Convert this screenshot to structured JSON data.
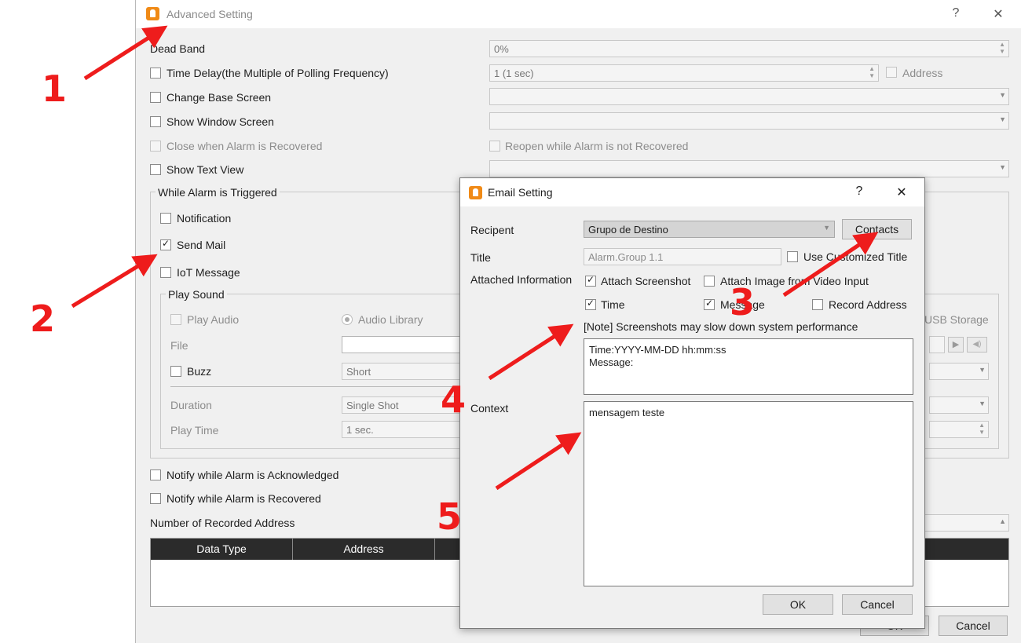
{
  "advanced": {
    "title": "Advanced Setting",
    "help": "?",
    "close": "✕",
    "dead_band_label": "Dead Band",
    "dead_band_value": "0%",
    "time_delay_label": "Time Delay(the Multiple of Polling Frequency)",
    "time_delay_value": "1 (1 sec)",
    "address_label": "Address",
    "change_base_screen_label": "Change Base Screen",
    "show_window_screen_label": "Show Window Screen",
    "close_when_recovered_label": "Close when Alarm is Recovered",
    "reopen_label": "Reopen while Alarm is not Recovered",
    "show_text_view_label": "Show Text View",
    "triggered_group_title": "While Alarm is Triggered",
    "notification_label": "Notification",
    "send_mail_label": "Send Mail",
    "iot_message_label": "IoT Message",
    "play_sound_title": "Play Sound",
    "play_audio_label": "Play Audio",
    "audio_library_label": "Audio Library",
    "usb_storage_label": "USB Storage",
    "file_label": "File",
    "buzz_label": "Buzz",
    "buzz_value": "Short",
    "duration_label": "Duration",
    "duration_value": "Single Shot",
    "play_time_label": "Play Time",
    "play_time_value": "1 sec.",
    "notify_ack_label": "Notify while Alarm is Acknowledged",
    "notify_recovered_label": "Notify while Alarm is Recovered",
    "recorded_address_label": "Number of Recorded Address",
    "table_headers": [
      "Data Type",
      "Address"
    ],
    "ok_label": "OK",
    "cancel_label": "Cancel"
  },
  "email": {
    "title": "Email Setting",
    "help": "?",
    "close": "✕",
    "recipient_label": "Recipent",
    "recipient_value": "Grupo de Destino",
    "contacts_label": "Contacts",
    "title_label": "Title",
    "title_value": "Alarm.Group 1.1",
    "use_custom_title_label": "Use Customized Title",
    "attached_info_label": "Attached Information",
    "attach_screenshot_label": "Attach Screenshot",
    "attach_image_label": "Attach Image from Video Input",
    "time_label": "Time",
    "message_label": "Message",
    "record_address_label": "Record Address",
    "note": "[Note] Screenshots may slow down system performance",
    "attached_preview": "Time:YYYY-MM-DD hh:mm:ss\nMessage:",
    "context_label": "Context",
    "context_value": "mensagem teste",
    "ok_label": "OK",
    "cancel_label": "Cancel"
  },
  "annotations": {
    "n1": "1",
    "n2": "2",
    "n3": "3",
    "n4": "4",
    "n5": "5",
    "color": "#ee1c1c"
  },
  "colors": {
    "window_bg": "#f0f0f0",
    "app_icon": "#f08a16",
    "table_header": "#2b2b2b"
  }
}
